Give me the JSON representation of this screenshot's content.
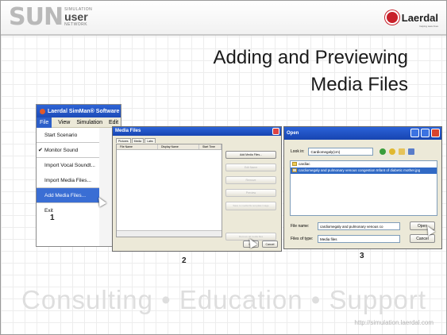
{
  "header": {
    "logo_sun_letters": "SUN",
    "logo_sun_small": "SIMULATION",
    "logo_sun_user": "user",
    "logo_sun_network": "NETWORK",
    "logo_laerdal": "Laerdal",
    "logo_laerdal_tag": "helping save lives"
  },
  "title": {
    "line1": "Adding and Previewing",
    "line2": "Media Files"
  },
  "shot1": {
    "app_title": "Laerdal SimMan® Software",
    "menus": [
      "File",
      "View",
      "Simulation",
      "Edit"
    ],
    "menu_items": [
      {
        "label": "Start Scenario",
        "checked": false
      },
      {
        "label": "Monitor Sound",
        "checked": true
      },
      {
        "label": "Import Vocal Soundt...",
        "checked": false
      },
      {
        "label": "Import Media Files...",
        "checked": false
      },
      {
        "label": "Add Media Files...",
        "checked": false,
        "selected": true
      },
      {
        "label": "Exit",
        "checked": false
      }
    ],
    "number": "1"
  },
  "shot2": {
    "window_title": "Media Files",
    "tabs": [
      "Pictures",
      "Media",
      "Labs"
    ],
    "columns": [
      "File Name",
      "Display Name",
      "Start Time"
    ],
    "buttons": [
      "Add Media Files...",
      "Edit Name",
      "Remove",
      "Preview",
      "Save to media file template image",
      "Remove all media files"
    ],
    "ok_label": "OK",
    "cancel_label": "Cancel",
    "number": "2"
  },
  "shot3": {
    "window_title": "Open",
    "look_in_label": "Look in:",
    "look_in_value": "Cardiomegaly(cm)",
    "files": [
      {
        "name": "cardiac",
        "selected": false
      },
      {
        "name": "cardiomegaly and pulmonary venous congestion Infant of diabetic mother.jpg",
        "selected": true
      }
    ],
    "file_name_label": "File name:",
    "file_name_value": "cardiomegaly and pulmonary venous co",
    "file_type_label": "Files of type:",
    "file_type_value": "Media files",
    "open_label": "Open",
    "cancel_label": "Cancel",
    "number": "3"
  },
  "footer": {
    "tagline": "Consulting  •  Education  •  Support",
    "url": "http://simulation.laerdal.com"
  },
  "colors": {
    "xp_blue": "#2b63d9",
    "selection": "#316ac5",
    "laerdal_red": "#c8202a"
  }
}
